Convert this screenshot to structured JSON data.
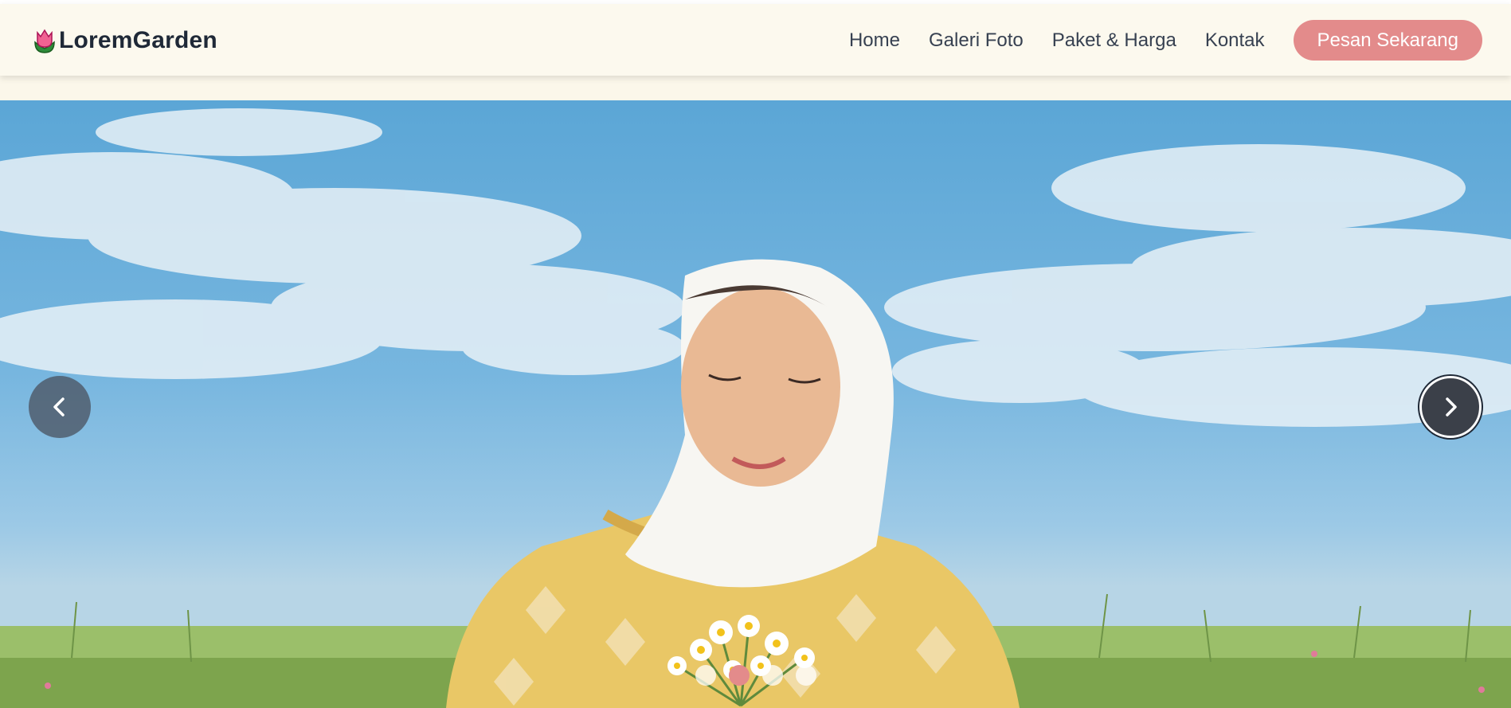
{
  "brand": {
    "name": "LoremGarden",
    "icon": "tulip-icon"
  },
  "nav": {
    "links": [
      "Home",
      "Galeri Foto",
      "Paket & Harga",
      "Kontak"
    ],
    "cta_label": "Pesan Sekarang"
  },
  "carousel": {
    "prev_icon": "chevron-left-icon",
    "next_icon": "chevron-right-icon",
    "slide_count": 4,
    "active_index": 1
  },
  "colors": {
    "accent": "#e38b8b",
    "navbar_bg": "#fcf9ee",
    "text_dark": "#1f2937"
  }
}
